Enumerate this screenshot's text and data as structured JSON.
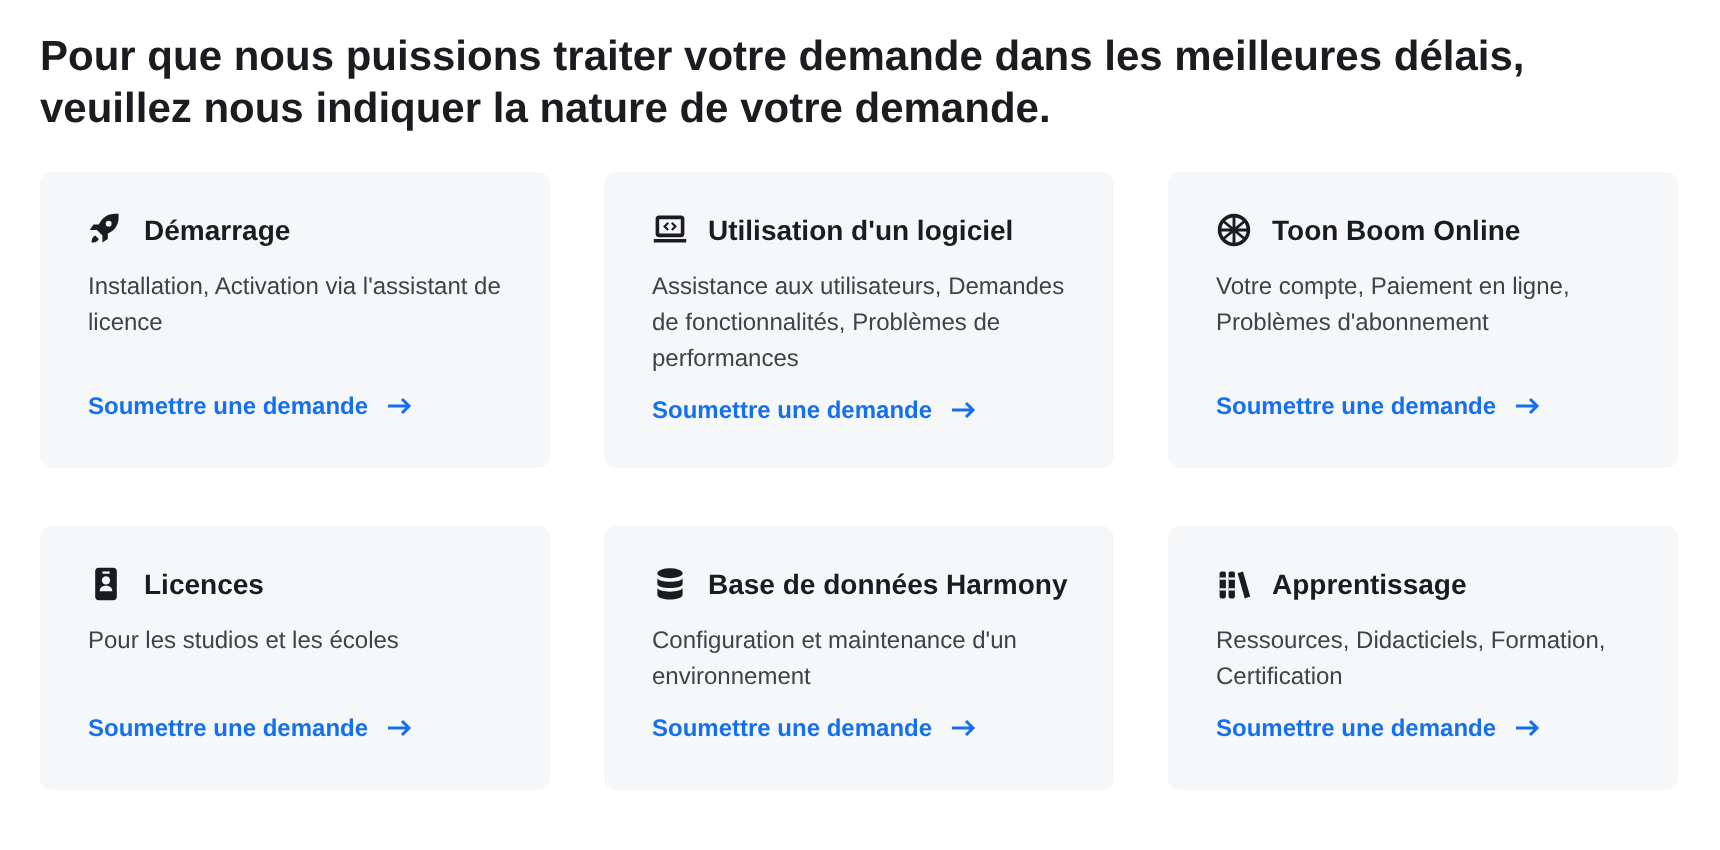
{
  "heading": "Pour que nous puissions traiter votre demande dans les meilleures délais, veuillez nous indiquer la nature de votre demande.",
  "cards": [
    {
      "title": "Démarrage",
      "description": "Installation, Activation via l'assistant de licence",
      "link": "Soumettre une demande"
    },
    {
      "title": "Utilisation d'un logiciel",
      "description": "Assistance aux utilisateurs, Demandes de fonctionnalités, Problèmes de performances",
      "link": "Soumettre une demande"
    },
    {
      "title": "Toon Boom Online",
      "description": "Votre compte, Paiement en ligne, Problèmes d'abonnement",
      "link": "Soumettre une demande"
    },
    {
      "title": "Licences",
      "description": "Pour les studios et les écoles",
      "link": "Soumettre une demande"
    },
    {
      "title": "Base de données Harmony",
      "description": "Configuration et maintenance d'un environnement",
      "link": "Soumettre une demande"
    },
    {
      "title": "Apprentissage",
      "description": "Ressources, Didacticiels, Formation, Certification",
      "link": "Soumettre une demande"
    }
  ]
}
